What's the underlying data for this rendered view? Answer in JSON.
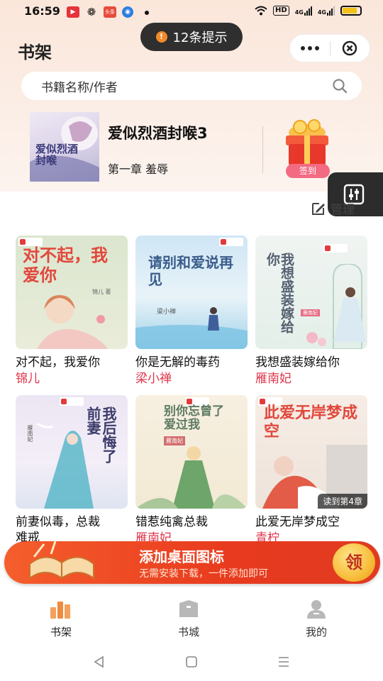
{
  "status_bar": {
    "time": "16:59",
    "network": "HD",
    "signal_1": "4G",
    "signal_2": "4G",
    "battery_level": 0.85
  },
  "toast": {
    "text": "12条提示",
    "icon": "!"
  },
  "header": {
    "title": "书架"
  },
  "search": {
    "placeholder": "书籍名称/作者"
  },
  "recent_book": {
    "title": "爱似烈酒封喉3",
    "chapter": "第一章 羞辱",
    "cover_text": "爱似烈酒封喉",
    "signin_label": "签到"
  },
  "manage": {
    "label": "管理"
  },
  "books": [
    {
      "title": "对不起，我爱你",
      "author": "锦儿",
      "cover_text": "对不起，我爱你",
      "cover_author": "锦儿 著"
    },
    {
      "title": "你是无解的毒药",
      "author": "梁小禅",
      "cover_text": "请别和爱说再见",
      "cover_author": "梁小禅"
    },
    {
      "title": "我想盛装嫁给你",
      "author": "雁南妃",
      "cover_text": "我想盛装嫁给你",
      "cover_author": "雁南妃"
    },
    {
      "title": "前妻似毒，总裁难戒",
      "title_line1": "前妻似毒，总裁",
      "title_line2": "难戒",
      "author": "",
      "cover_text": "我后悔了前妻",
      "cover_author": "雁南妃"
    },
    {
      "title": "错惹纯禽总裁",
      "author": "雁南妃",
      "cover_text": "别你忘曾了爱过我",
      "cover_author": "雁南妃"
    },
    {
      "title": "此爱无岸梦成空",
      "author": "青柠",
      "cover_text": "此爱无岸梦成空",
      "cover_author": "",
      "read_tag": "读到第4章"
    }
  ],
  "banner": {
    "title": "添加桌面图标",
    "subtitle": "无需安装下载，一件添加即可",
    "button": "领"
  },
  "tabs": [
    {
      "label": "书架",
      "icon": "bookshelf-icon",
      "active": true
    },
    {
      "label": "书城",
      "icon": "bookstore-icon",
      "active": false
    },
    {
      "label": "我的",
      "icon": "profile-icon",
      "active": false
    }
  ],
  "colors": {
    "accent": "#e0344a",
    "banner": "#e83a1e",
    "tab_active": "#f08a3c",
    "tab_inactive": "#b8b8b8"
  }
}
